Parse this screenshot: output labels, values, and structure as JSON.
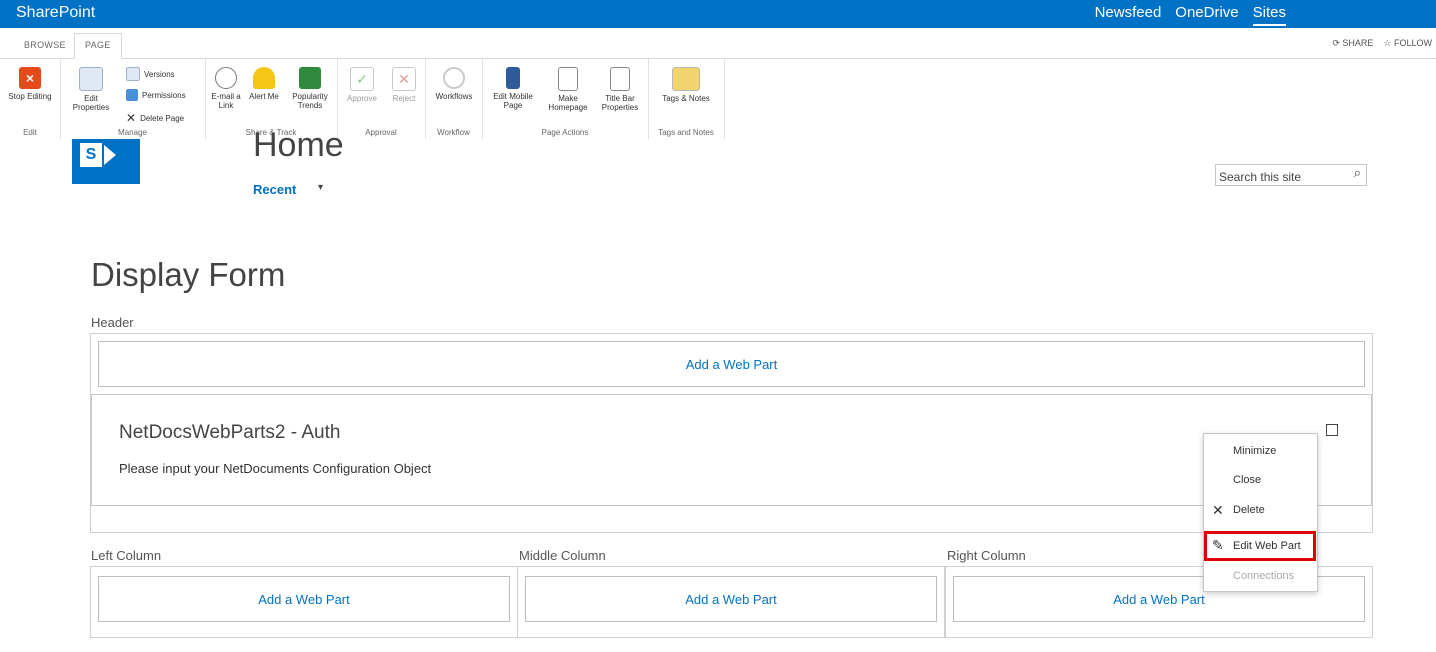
{
  "suite": {
    "brand": "SharePoint",
    "links": [
      "Newsfeed",
      "OneDrive",
      "Sites"
    ]
  },
  "tabs": {
    "browse": "BROWSE",
    "page": "PAGE"
  },
  "share_follow": {
    "share": "SHARE",
    "follow": "FOLLOW"
  },
  "ribbon": {
    "groups": {
      "edit": "Edit",
      "manage": "Manage",
      "share_track": "Share & Track",
      "approval": "Approval",
      "workflow": "Workflow",
      "page_actions": "Page Actions",
      "tags_notes": "Tags and Notes"
    },
    "buttons": {
      "stop_editing": "Stop Editing",
      "edit_properties": "Edit Properties",
      "versions": "Versions",
      "permissions": "Permissions",
      "delete_page": "Delete Page",
      "email_link": "E-mail a Link",
      "alert_me": "Alert Me",
      "popularity_trends": "Popularity Trends",
      "approve": "Approve",
      "reject": "Reject",
      "workflows": "Workflows",
      "edit_mobile_page": "Edit Mobile Page",
      "make_homepage": "Make Homepage",
      "title_bar_properties": "Title Bar Properties",
      "tags_notes": "Tags & Notes"
    }
  },
  "site": {
    "title": "Home",
    "recent": "Recent",
    "search_placeholder": "Search this site"
  },
  "page": {
    "title": "Display Form",
    "header_label": "Header",
    "add_web_part": "Add a Web Part",
    "left_column": "Left Column",
    "middle_column": "Middle Column",
    "right_column": "Right Column"
  },
  "webpart": {
    "title": "NetDocsWebParts2 - Auth",
    "body": "Please input your NetDocuments Configuration Object"
  },
  "menu": {
    "minimize": "Minimize",
    "close": "Close",
    "delete": "Delete",
    "edit_web_part": "Edit Web Part",
    "connections": "Connections"
  },
  "colors": {
    "suite": "#0072c6",
    "link": "#0072c6",
    "highlight": "#e00000"
  }
}
